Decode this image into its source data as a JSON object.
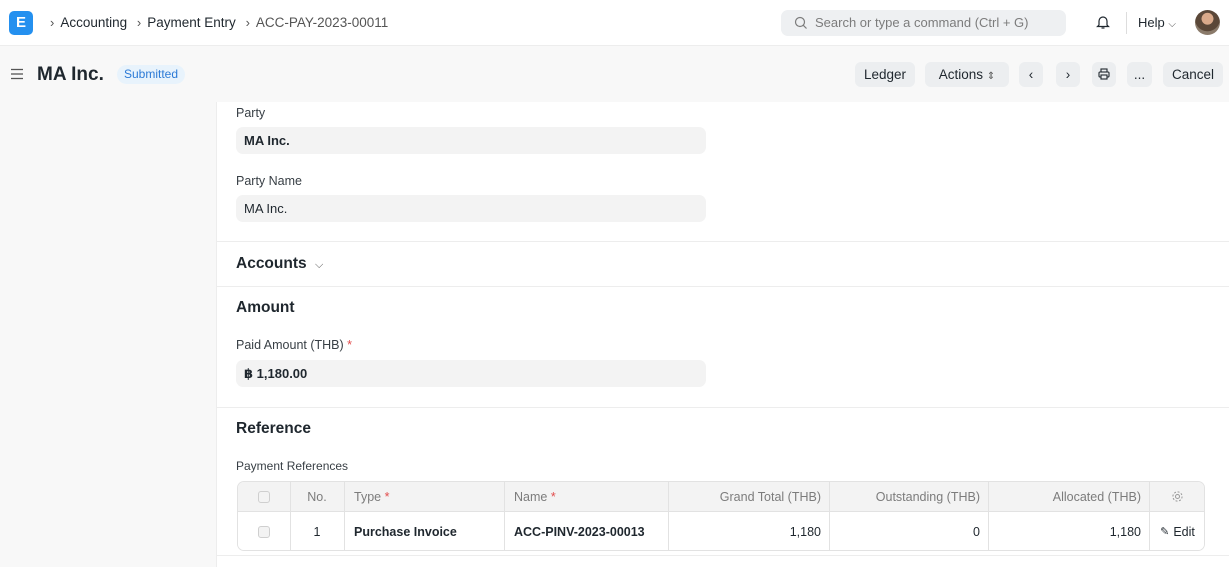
{
  "navbar": {
    "logo_letter": "E",
    "breadcrumbs": [
      "Accounting",
      "Payment Entry",
      "ACC-PAY-2023-00011"
    ],
    "search_placeholder": "Search or type a command (Ctrl + G)",
    "help_label": "Help"
  },
  "page": {
    "title": "MA Inc.",
    "status": "Submitted",
    "buttons": {
      "ledger": "Ledger",
      "actions": "Actions",
      "more": "...",
      "cancel": "Cancel"
    }
  },
  "form": {
    "party": {
      "label": "Party",
      "value": "MA Inc."
    },
    "party_name": {
      "label": "Party Name",
      "value": "MA Inc."
    },
    "accounts_section": "Accounts",
    "amount_section": "Amount",
    "paid_amount": {
      "label": "Paid Amount (THB)",
      "required_mark": "*",
      "value": "฿ 1,180.00"
    },
    "reference_section": "Reference",
    "payment_references_label": "Payment References"
  },
  "table": {
    "columns": {
      "no": "No.",
      "type": "Type",
      "name": "Name",
      "grand_total": "Grand Total (THB)",
      "outstanding": "Outstanding (THB)",
      "allocated": "Allocated (THB)"
    },
    "required_mark": "*",
    "rows": [
      {
        "no": "1",
        "type": "Purchase Invoice",
        "name": "ACC-PINV-2023-00013",
        "grand_total": "1,180",
        "outstanding": "0",
        "allocated": "1,180",
        "edit": "Edit"
      }
    ]
  },
  "colors": {
    "accent": "#2490ef",
    "status_bg": "#e8f3fc",
    "status_text": "#2c7ad6",
    "required": "#e24c4c"
  }
}
